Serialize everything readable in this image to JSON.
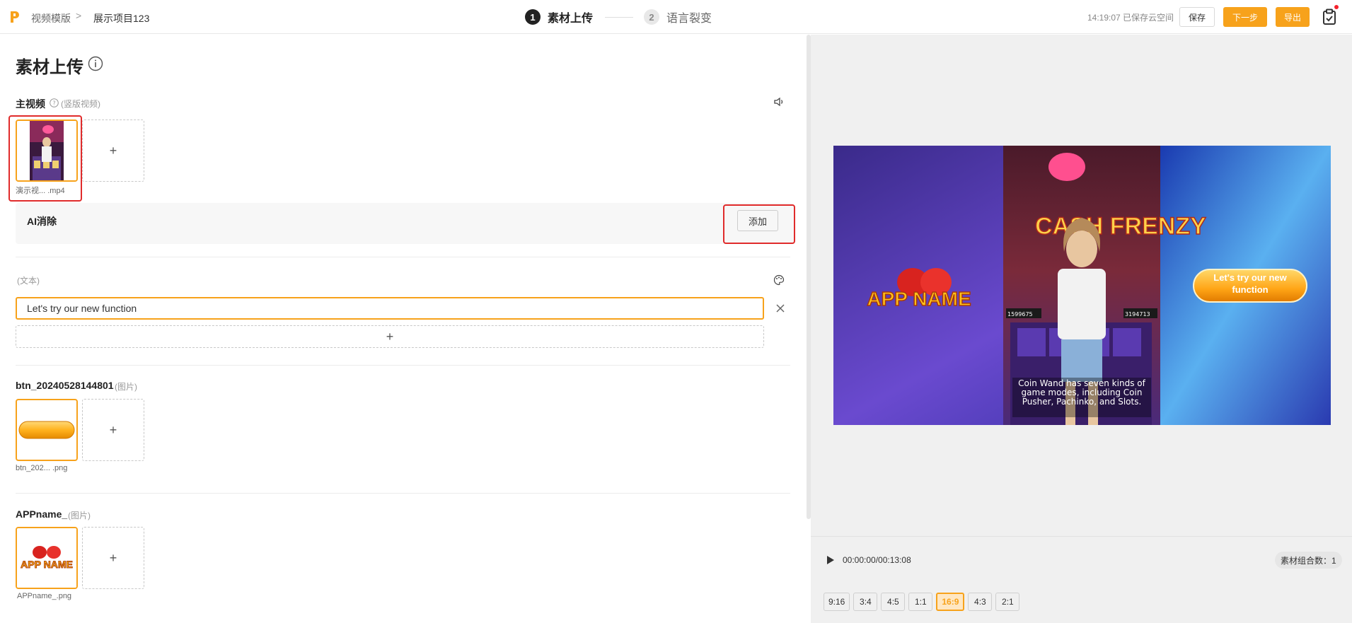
{
  "header": {
    "crumb_root": "视频模版",
    "crumb_sep": ">",
    "crumb_project": "展示项目123",
    "steps": [
      {
        "num": "1",
        "label": "素材上传"
      },
      {
        "num": "2",
        "label": "语言裂变"
      }
    ],
    "save_status": "14:19:07 已保存云空间",
    "save_label": "保存",
    "next_label": "下一步",
    "export_label": "导出",
    "accent": "#f7a21b"
  },
  "page": {
    "title": "素材上传"
  },
  "main_video": {
    "label": "主视频",
    "hint": "(竖版视频)",
    "file_name": "演示视...   .mp4",
    "add_symbol": "+"
  },
  "ai_remove": {
    "label": "AI消除",
    "add_label": "添加"
  },
  "text_section": {
    "hint": "(文本)",
    "value": "Let's try our new function",
    "add_symbol": "+"
  },
  "btn_asset": {
    "label": "btn_20240528144801",
    "hint": "(图片)",
    "file_name": "btn_202...   .png",
    "add_symbol": "+"
  },
  "appname_asset": {
    "label": "APPname_",
    "hint": "(图片)",
    "thumb_text": "APP NAME",
    "file_name": "APPname_.png",
    "add_symbol": "+"
  },
  "preview": {
    "app_name": "APP NAME",
    "cta_text": "Let's try our new function",
    "game_title": "CASH FRENZY",
    "subtitle": "Coin Wand has seven kinds of game modes, including Coin Pusher, Pachinko, and Slots.",
    "score_left": "1599675",
    "score_right": "3194713"
  },
  "player": {
    "time": "00:00:00/00:13:08",
    "combo_count": "素材组合数：1",
    "ratios": [
      "9:16",
      "3:4",
      "4:5",
      "1:1",
      "16:9",
      "4:3",
      "2:1"
    ],
    "active_ratio": "16:9"
  }
}
